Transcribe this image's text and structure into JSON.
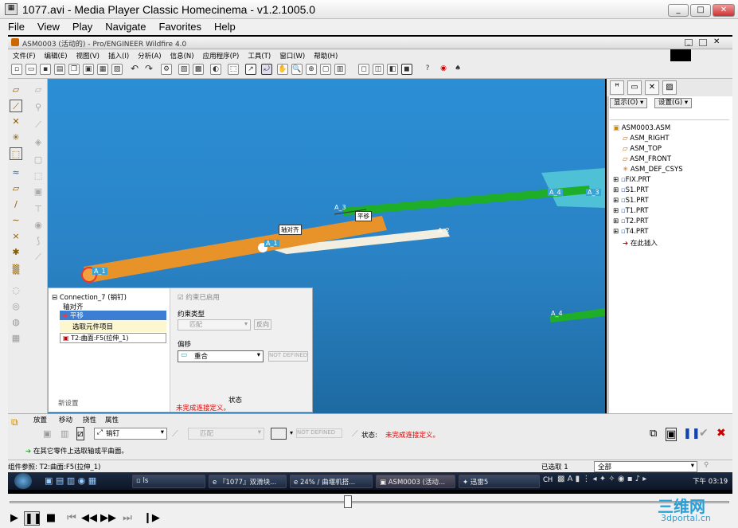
{
  "window": {
    "title": "1077.avi - Media Player Classic Homecinema - v1.2.1005.0",
    "min": "_",
    "max": "□",
    "close": "✕"
  },
  "menu": [
    "File",
    "View",
    "Play",
    "Navigate",
    "Favorites",
    "Help"
  ],
  "proe": {
    "title": "ASM0003 (活动的) - Pro/ENGINEER Wildfire 4.0",
    "menu": [
      "文件(F)",
      "编辑(E)",
      "视图(V)",
      "插入(I)",
      "分析(A)",
      "信息(N)",
      "应用程序(P)",
      "工具(T)",
      "窗口(W)",
      "帮助(H)"
    ],
    "viewport_labels": {
      "a1": "A_1",
      "a1b": "A_1",
      "a2": "A_2",
      "a3": "A_3",
      "a4": "A_4",
      "a4b": "A_4",
      "a3b": "A_3",
      "tag_zdq": "轴对齐",
      "tag_py": "平移"
    },
    "nav": {
      "show_btn": "显示(O) ▾",
      "settings_btn": "设置(G) ▾",
      "tree": [
        {
          "label": "ASM0003.ASM",
          "icon": "assembly-icon"
        },
        {
          "label": "ASM_RIGHT",
          "icon": "datum-plane-icon"
        },
        {
          "label": "ASM_TOP",
          "icon": "datum-plane-icon"
        },
        {
          "label": "ASM_FRONT",
          "icon": "datum-plane-icon"
        },
        {
          "label": "ASM_DEF_CSYS",
          "icon": "csys-icon"
        },
        {
          "label": "FIX.PRT",
          "icon": "part-icon"
        },
        {
          "label": "S1.PRT",
          "icon": "part-icon"
        },
        {
          "label": "S1.PRT",
          "icon": "part-icon"
        },
        {
          "label": "T1.PRT",
          "icon": "part-icon"
        },
        {
          "label": "T2.PRT",
          "icon": "part-icon"
        },
        {
          "label": "T4.PRT",
          "icon": "part-icon"
        },
        {
          "label": "在此插入",
          "icon": "insert-here-icon"
        }
      ]
    },
    "connection": {
      "header": "Connection_7 (销钉)",
      "items": [
        "轴对齐",
        "平移"
      ],
      "select_hint": "选取元件项目",
      "ref": "T2:曲面:F5(拉伸_1)",
      "new_set": "新设置",
      "enabled_label": "约束已启用",
      "type_label": "约束类型",
      "type_value": "匹配",
      "reverse_btn": "反向",
      "offset_label": "偏移",
      "offset_value": "重合",
      "not_defined": "NOT DEFINED",
      "status_label": "状态",
      "status_value": "未完成连接定义。"
    },
    "dashboard": {
      "tabs": [
        "放置",
        "移动",
        "挠性",
        "属性"
      ],
      "connection_type": "销钉",
      "match": "匹配",
      "not_defined": "NOT DEFINED",
      "status_label": "状态:",
      "status_value": "未完成连接定义。",
      "hint": "在其它零件上选取轴或平曲面。"
    },
    "statusbar": {
      "ref": "组件参照: T2:曲面:F5(拉伸_1)",
      "selected": "已选取 1",
      "filter": "全部"
    }
  },
  "taskbar": {
    "items": [
      "ls",
      "『1077』双滑块...",
      "24% / 曲堰机搭...",
      "ASM0003 (活动...",
      "迅雷5"
    ],
    "lang": "CH",
    "time": "下午 03:19"
  },
  "player": {
    "watermark_line1": "三维网",
    "watermark_line2": "3dportal.cn",
    "progress": 0.47
  },
  "colors": {
    "viewport": "#2a82c4",
    "orange": "#e8922a",
    "green": "#1fae27",
    "cyan": "#4fc1d6"
  }
}
